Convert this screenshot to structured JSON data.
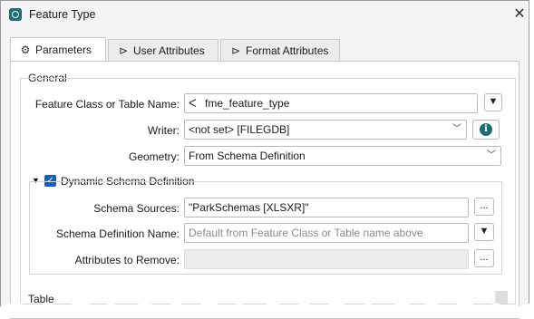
{
  "window": {
    "title": "Feature Type"
  },
  "tabs": [
    {
      "label": "Parameters",
      "icon": "gear-icon",
      "active": true
    },
    {
      "label": "User Attributes",
      "icon": "tag-icon",
      "active": false
    },
    {
      "label": "Format Attributes",
      "icon": "tag-icon",
      "active": false
    }
  ],
  "general": {
    "section_label": "General",
    "feature_class": {
      "label": "Feature Class or Table Name:",
      "value": "fme_feature_type"
    },
    "writer": {
      "label": "Writer:",
      "value": "<not set> [FILEGDB]"
    },
    "geometry": {
      "label": "Geometry:",
      "value": "From Schema Definition"
    }
  },
  "dynamic_schema": {
    "label": "Dynamic Schema Definition",
    "checked": true,
    "schema_sources": {
      "label": "Schema Sources:",
      "value": "\"ParkSchemas [XLSXR]\""
    },
    "schema_definition_name": {
      "label": "Schema Definition Name:",
      "placeholder": "Default from Feature Class or Table name above"
    },
    "attributes_to_remove": {
      "label": "Attributes to Remove:",
      "value": ""
    }
  },
  "table": {
    "section_label": "Table"
  },
  "buttons": {
    "ellipsis": "...",
    "dropdown": "▼",
    "info": "i"
  },
  "colors": {
    "accent": "#1e6b73",
    "checkbox": "#1a5fb4"
  }
}
